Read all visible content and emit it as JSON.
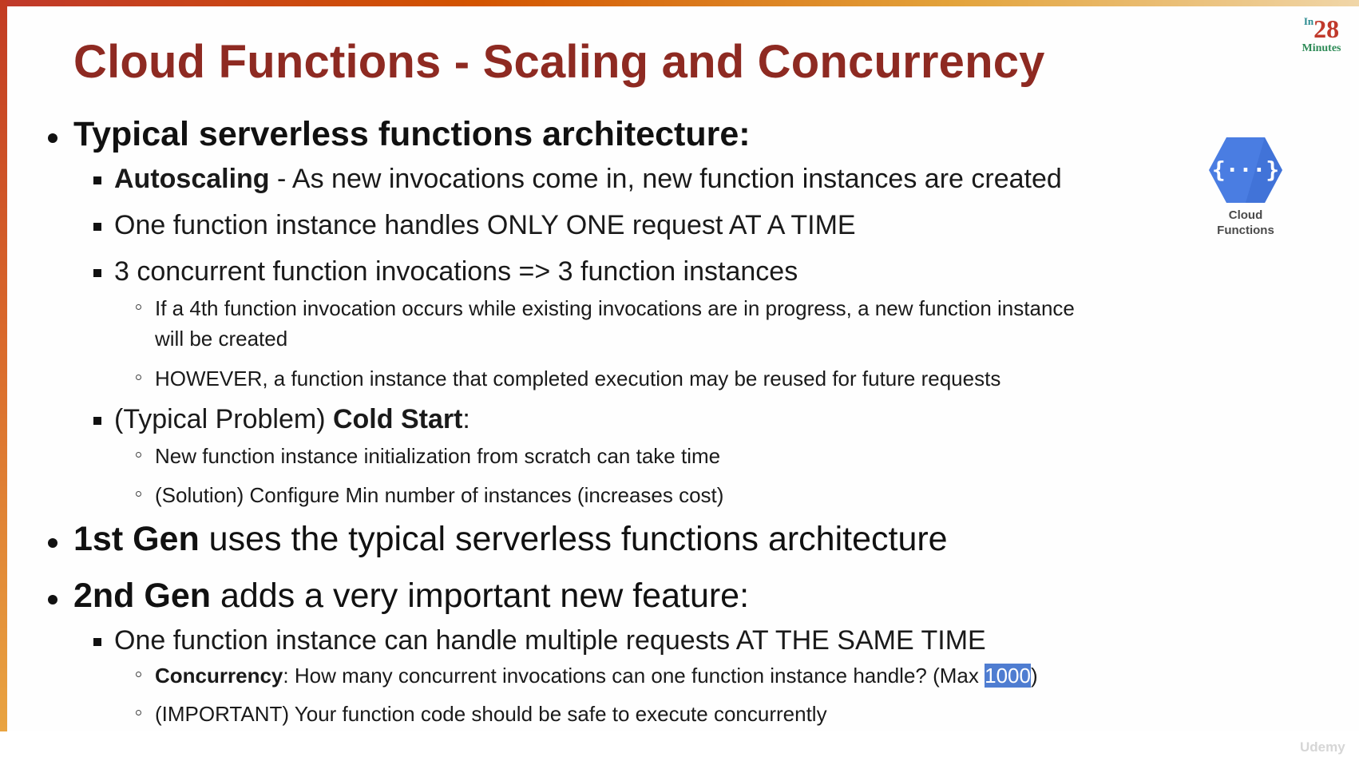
{
  "slide": {
    "title": "Cloud Functions - Scaling and Concurrency",
    "logo": {
      "prefix": "In",
      "number": "28",
      "word": "Minutes"
    },
    "product_icon": {
      "name": "cloud-functions-icon",
      "label_line1": "Cloud",
      "label_line2": "Functions",
      "color": "#4a7de2"
    },
    "bullets": {
      "b1": "Typical serverless functions architecture:",
      "b1_1_bold": "Autoscaling",
      "b1_1_rest": " - As new invocations come in, new function instances are created",
      "b1_2": "One function instance handles ONLY ONE request AT A TIME",
      "b1_3": "3 concurrent function invocations => 3 function instances",
      "b1_3_1_line1": "If a 4th function invocation occurs while existing invocations are in progress, a new function instance",
      "b1_3_1_line2": "will be created",
      "b1_3_2": "HOWEVER, a function instance that completed execution may be reused for future requests",
      "b1_4_rest": "(Typical Problem) ",
      "b1_4_bold": "Cold Start",
      "b1_4_colon": ":",
      "b1_4_1": "New function instance initialization from scratch can take time",
      "b1_4_2": "(Solution) Configure Min number of instances (increases cost)",
      "b2_bold": "1st Gen",
      "b2_rest": " uses the typical serverless functions architecture",
      "b3_bold": "2nd Gen",
      "b3_rest": " adds a very important new feature:",
      "b3_1": "One function instance can handle multiple requests AT THE SAME TIME",
      "b3_1_1_bold": "Concurrency",
      "b3_1_1_rest": ": How many concurrent invocations can one function instance handle? (Max ",
      "b3_1_1_value": "1000",
      "b3_1_1_end": ")",
      "b3_1_2": "(IMPORTANT) Your function code should be safe to execute concurrently"
    },
    "watermark": "Udemy",
    "colors": {
      "title": "#8e2a22",
      "accent_bar": "#d9682b",
      "selection": "#4f7dd1"
    }
  }
}
